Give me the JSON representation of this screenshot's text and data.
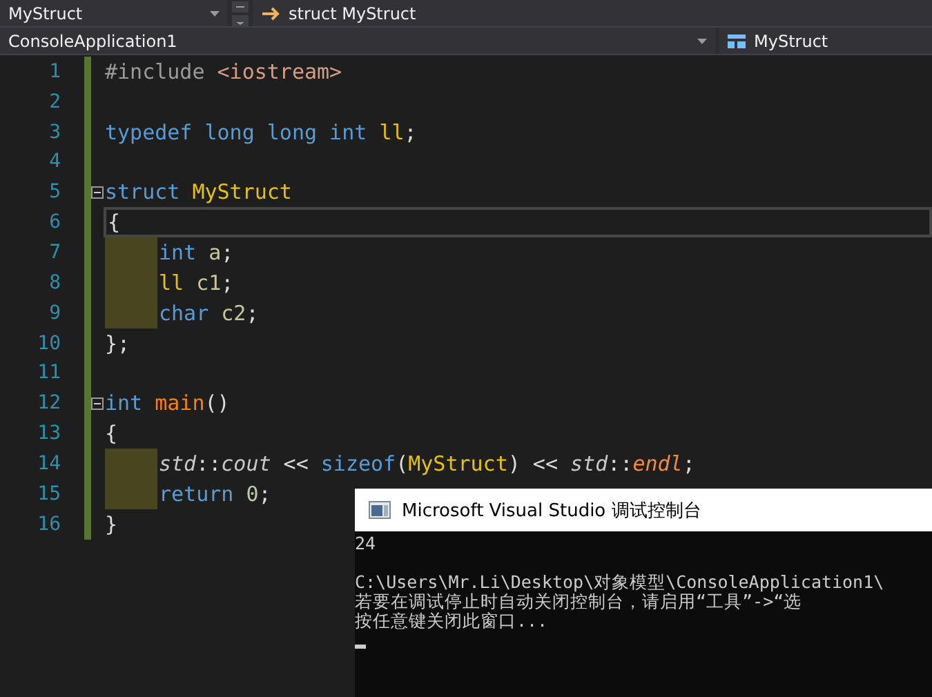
{
  "navigation_bar": {
    "scope": "MyStruct",
    "member": "struct MyStruct",
    "project": "ConsoleApplication1",
    "symbol": "MyStruct"
  },
  "editor": {
    "lines": [
      {
        "number": "1",
        "current": false,
        "fold": false,
        "guide": false,
        "tokens": [
          {
            "text": "#include ",
            "kind": "preproc"
          },
          {
            "text": "<iostream>",
            "kind": "string"
          }
        ]
      },
      {
        "number": "2",
        "current": false,
        "fold": false,
        "guide": false
      },
      {
        "number": "3",
        "current": false,
        "fold": false,
        "guide": false,
        "tokens": [
          {
            "text": "typedef long long int ",
            "kind": "keyword"
          },
          {
            "text": "ll",
            "kind": "type"
          },
          {
            "text": ";",
            "kind": "punct"
          }
        ]
      },
      {
        "number": "4",
        "current": false,
        "fold": false,
        "guide": false
      },
      {
        "number": "5",
        "current": false,
        "fold": true,
        "guide": false,
        "tokens": [
          {
            "text": "struct ",
            "kind": "keyword"
          },
          {
            "text": "MyStruct",
            "kind": "type"
          }
        ]
      },
      {
        "number": "6",
        "current": true,
        "fold": false,
        "guide": false,
        "tokens": [
          {
            "text": "{",
            "kind": "punct"
          }
        ]
      },
      {
        "number": "7",
        "current": false,
        "fold": false,
        "guide": true,
        "tokens": [
          {
            "text": "int ",
            "kind": "keyword"
          },
          {
            "text": "a",
            "kind": "var"
          },
          {
            "text": ";",
            "kind": "punct"
          }
        ]
      },
      {
        "number": "8",
        "current": false,
        "fold": false,
        "guide": true,
        "tokens": [
          {
            "text": "ll ",
            "kind": "type"
          },
          {
            "text": "c1",
            "kind": "var"
          },
          {
            "text": ";",
            "kind": "punct"
          }
        ]
      },
      {
        "number": "9",
        "current": false,
        "fold": false,
        "guide": true,
        "tokens": [
          {
            "text": "char ",
            "kind": "keyword"
          },
          {
            "text": "c2",
            "kind": "var"
          },
          {
            "text": ";",
            "kind": "punct"
          }
        ]
      },
      {
        "number": "10",
        "current": false,
        "fold": false,
        "guide": false,
        "tokens": [
          {
            "text": "};",
            "kind": "punct"
          }
        ]
      },
      {
        "number": "11",
        "current": false,
        "fold": false,
        "guide": false
      },
      {
        "number": "12",
        "current": false,
        "fold": true,
        "guide": false,
        "tokens": [
          {
            "text": "int ",
            "kind": "keyword"
          },
          {
            "text": "main",
            "kind": "func"
          },
          {
            "text": "()",
            "kind": "punct"
          }
        ]
      },
      {
        "number": "13",
        "current": false,
        "fold": false,
        "guide": false,
        "tokens": [
          {
            "text": "{",
            "kind": "punct"
          }
        ]
      },
      {
        "number": "14",
        "current": false,
        "fold": false,
        "guide": true,
        "tokens": [
          {
            "text": "std",
            "kind": "ns"
          },
          {
            "text": "::",
            "kind": "punct"
          },
          {
            "text": "cout",
            "kind": "ns"
          },
          {
            "text": " << ",
            "kind": "punct"
          },
          {
            "text": "sizeof",
            "kind": "keyword"
          },
          {
            "text": "(",
            "kind": "punct"
          },
          {
            "text": "MyStruct",
            "kind": "type"
          },
          {
            "text": ") << ",
            "kind": "punct"
          },
          {
            "text": "std",
            "kind": "ns"
          },
          {
            "text": "::",
            "kind": "punct"
          },
          {
            "text": "endl",
            "kind": "member"
          },
          {
            "text": ";",
            "kind": "punct"
          }
        ]
      },
      {
        "number": "15",
        "current": false,
        "fold": false,
        "guide": true,
        "tokens": [
          {
            "text": "return ",
            "kind": "keyword"
          },
          {
            "text": "0",
            "kind": "number"
          },
          {
            "text": ";",
            "kind": "punct"
          }
        ]
      },
      {
        "number": "16",
        "current": false,
        "fold": false,
        "guide": false,
        "tokens": [
          {
            "text": "}",
            "kind": "punct"
          }
        ]
      }
    ]
  },
  "console": {
    "title": "Microsoft Visual Studio 调试控制台",
    "result": "24",
    "lines": [
      "C:\\Users\\Mr.Li\\Desktop\\对象模型\\ConsoleApplication1\\",
      "若要在调试停止时自动关闭控制台，请启用“工具”->“选",
      "按任意键关闭此窗口..."
    ]
  }
}
